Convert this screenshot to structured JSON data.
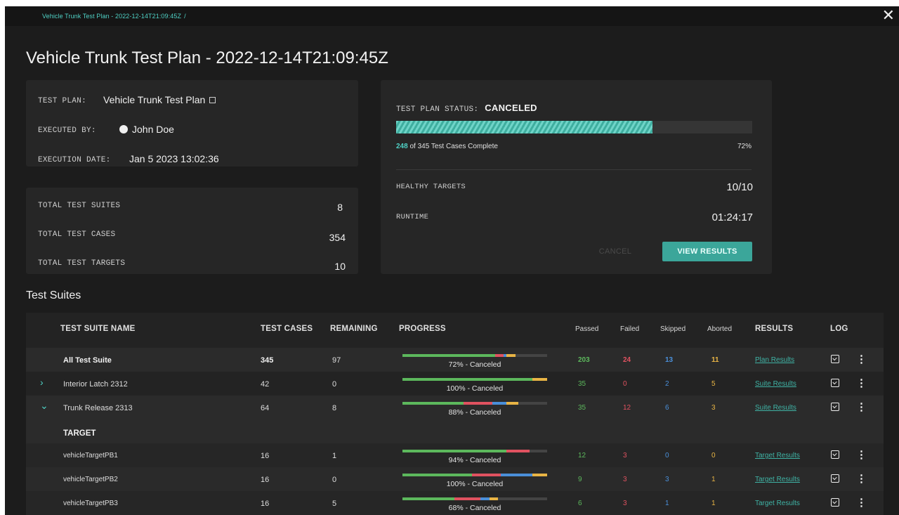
{
  "breadcrumb": {
    "path": "Vehicle Trunk Test Plan - 2022-12-14T21:09:45Z",
    "separator": "/"
  },
  "close_label": "✕",
  "page_title": "Vehicle Trunk Test Plan - 2022-12-14T21:09:45Z",
  "plan_info": {
    "test_plan_label": "TEST PLAN:",
    "test_plan_value": "Vehicle Trunk Test Plan",
    "executed_by_label": "EXECUTED BY:",
    "executed_by_value": "John Doe",
    "execution_date_label": "EXECUTION DATE:",
    "execution_date_value": "Jan 5 2023 13:02:36"
  },
  "totals": {
    "suites_label": "TOTAL TEST SUITES",
    "suites_value": "8",
    "cases_label": "TOTAL TEST CASES",
    "cases_value": "354",
    "targets_label": "TOTAL TEST TARGETS",
    "targets_value": "10"
  },
  "status": {
    "label": "TEST PLAN STATUS:",
    "value": "CANCELED",
    "progress_fraction": 0.72,
    "complete_count": "248",
    "complete_text": "of 345 Test Cases Complete",
    "percent": "72%",
    "healthy_label": "HEALTHY TARGETS",
    "healthy_value": "10/10",
    "runtime_label": "RUNTIME",
    "runtime_value": "01:24:17",
    "cancel_button": "CANCEL",
    "view_results_button": "VIEW RESULTS"
  },
  "section_title": "Test Suites",
  "colors": {
    "passed": "#5cb85c",
    "failed": "#e05260",
    "skipped": "#4a8fd9",
    "aborted": "#e8b445",
    "accent": "#3ba69a"
  },
  "table": {
    "headers": {
      "name": "TEST SUITE NAME",
      "cases": "TEST CASES",
      "remaining": "REMAINING",
      "progress": "PROGRESS",
      "passed": "Passed",
      "failed": "Failed",
      "skipped": "Skipped",
      "aborted": "Aborted",
      "results": "RESULTS",
      "log": "LOG"
    },
    "target_header": "TARGET",
    "rows": [
      {
        "name": "All Test Suite",
        "cases": "345",
        "remaining": "97",
        "progress": "72% - Canceled",
        "bar": [
          0.64,
          0.06,
          0.02,
          0.06
        ],
        "passed": "203",
        "failed": "24",
        "skipped": "13",
        "aborted": "11",
        "results": "Plan Results"
      },
      {
        "name": "Interior Latch 2312",
        "cases": "42",
        "remaining": "0",
        "progress": "100% - Canceled",
        "bar": [
          0.9,
          0.0,
          0.0,
          0.1
        ],
        "passed": "35",
        "failed": "0",
        "skipped": "2",
        "aborted": "5",
        "results": "Suite Results"
      },
      {
        "name": "Trunk Release 2313",
        "cases": "64",
        "remaining": "8",
        "progress": "88% - Canceled",
        "bar": [
          0.42,
          0.2,
          0.1,
          0.08
        ],
        "passed": "35",
        "failed": "12",
        "skipped": "6",
        "aborted": "3",
        "results": "Suite Results"
      },
      {
        "name": "vehicleTargetPB1",
        "cases": "16",
        "remaining": "1",
        "progress": "94% - Canceled",
        "bar": [
          0.72,
          0.16,
          0.0,
          0.0
        ],
        "passed": "12",
        "failed": "3",
        "skipped": "0",
        "aborted": "0",
        "results": "Target Results"
      },
      {
        "name": "vehicleTargetPB2",
        "cases": "16",
        "remaining": "0",
        "progress": "100% - Canceled",
        "bar": [
          0.48,
          0.2,
          0.22,
          0.1
        ],
        "passed": "9",
        "failed": "3",
        "skipped": "3",
        "aborted": "1",
        "results": "Target Results"
      },
      {
        "name": "vehicleTargetPB3",
        "cases": "16",
        "remaining": "5",
        "progress": "68% - Canceled",
        "bar": [
          0.36,
          0.18,
          0.06,
          0.06
        ],
        "passed": "6",
        "failed": "3",
        "skipped": "1",
        "aborted": "1",
        "results": "Target Results"
      }
    ]
  }
}
